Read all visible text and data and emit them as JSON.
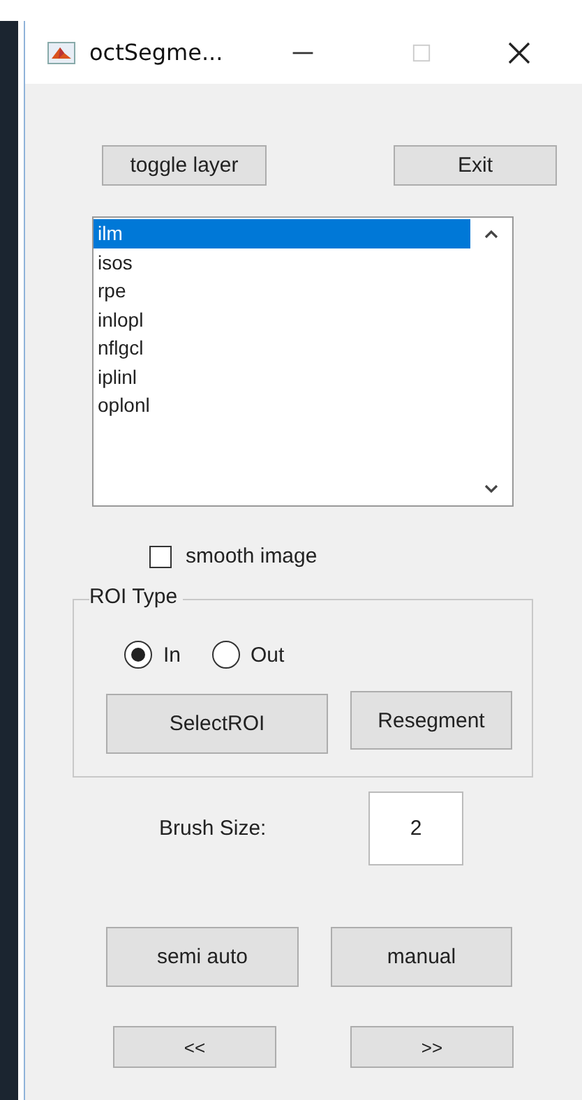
{
  "window": {
    "title": "octSegme..."
  },
  "top_buttons": [
    "toggle layer",
    "Exit"
  ],
  "layers": [
    {
      "label": "ilm",
      "selected": true
    },
    {
      "label": "isos",
      "selected": false
    },
    {
      "label": "rpe",
      "selected": false
    },
    {
      "label": "inlopl",
      "selected": false
    },
    {
      "label": "nflgcl",
      "selected": false
    },
    {
      "label": "iplinl",
      "selected": false
    },
    {
      "label": "oplonl",
      "selected": false
    }
  ],
  "smooth_image": {
    "label": "smooth image",
    "checked": false
  },
  "roi_type": {
    "title": "ROI Type",
    "options": [
      {
        "label": "In",
        "selected": true
      },
      {
        "label": "Out",
        "selected": false
      }
    ],
    "buttons": [
      "SelectROI",
      "Resegment"
    ]
  },
  "brush_size": {
    "label": "Brush Size:",
    "value": "2"
  },
  "mode_buttons": [
    "semi auto",
    "manual"
  ],
  "nav_buttons": [
    "<<",
    ">>"
  ]
}
